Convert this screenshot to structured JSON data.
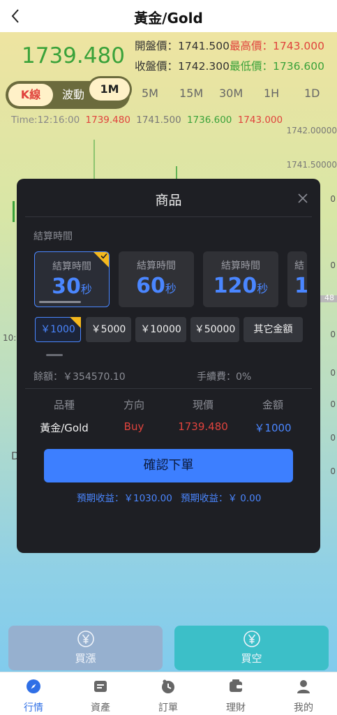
{
  "header": {
    "title": "黃金/Gold"
  },
  "quote": {
    "price": "1739.480",
    "open_label": "開盤價：",
    "open": "1741.500",
    "high_label": "最高價：",
    "high": "1743.000",
    "close_label": "收盤價：",
    "close": "1742.300",
    "low_label": "最低價：",
    "low": "1736.600"
  },
  "periods": {
    "kline_label": "K線",
    "wave_label": "波動",
    "items": [
      "1M",
      "5M",
      "15M",
      "30M",
      "1H",
      "1D"
    ],
    "active": "1M"
  },
  "timeline": {
    "label": "Time:",
    "time": "12:16:00",
    "v1": "1739.480",
    "v2": "1741.500",
    "v3": "1736.600",
    "v4": "1743.000"
  },
  "chart": {
    "y_labels": [
      "1742.00000",
      "1741.50000"
    ],
    "right_partials": [
      "0",
      "0",
      "48",
      "0",
      "0",
      "0",
      "0",
      "0"
    ],
    "left_partials": [
      "10:",
      "D"
    ]
  },
  "colors": {
    "accent": "#4a86ff",
    "up": "#3aa23a",
    "down": "#e0433d",
    "badge": "#f5b81c"
  },
  "modal": {
    "title": "商品",
    "section_label": "結算時間",
    "time_options": [
      {
        "label": "結算時間",
        "value": "30",
        "unit": "秒"
      },
      {
        "label": "結算時間",
        "value": "60",
        "unit": "秒"
      },
      {
        "label": "結算時間",
        "value": "120",
        "unit": "秒"
      },
      {
        "label": "結",
        "value": "1",
        "unit": ""
      }
    ],
    "amount_options": [
      "￥1000",
      "￥5000",
      "￥10000",
      "￥50000",
      "其它金額"
    ],
    "balance_label": "餘額：",
    "balance": "￥354570.10",
    "fee_label": "手續費：",
    "fee": "0%",
    "columns": [
      "品種",
      "方向",
      "現價",
      "金額"
    ],
    "order": {
      "symbol": "黃金/Gold",
      "direction": "Buy",
      "price": "1739.480",
      "amount": "￥1000"
    },
    "confirm_label": "確認下單",
    "expect1_label": "預期收益：",
    "expect1": "￥1030.00",
    "expect2_label": "預期收益：",
    "expect2": "￥ 0.00"
  },
  "actions": {
    "buy_label": "買漲",
    "sell_label": "買空"
  },
  "tabbar": {
    "items": [
      "行情",
      "資產",
      "訂單",
      "理財",
      "我的"
    ],
    "active": "行情"
  }
}
